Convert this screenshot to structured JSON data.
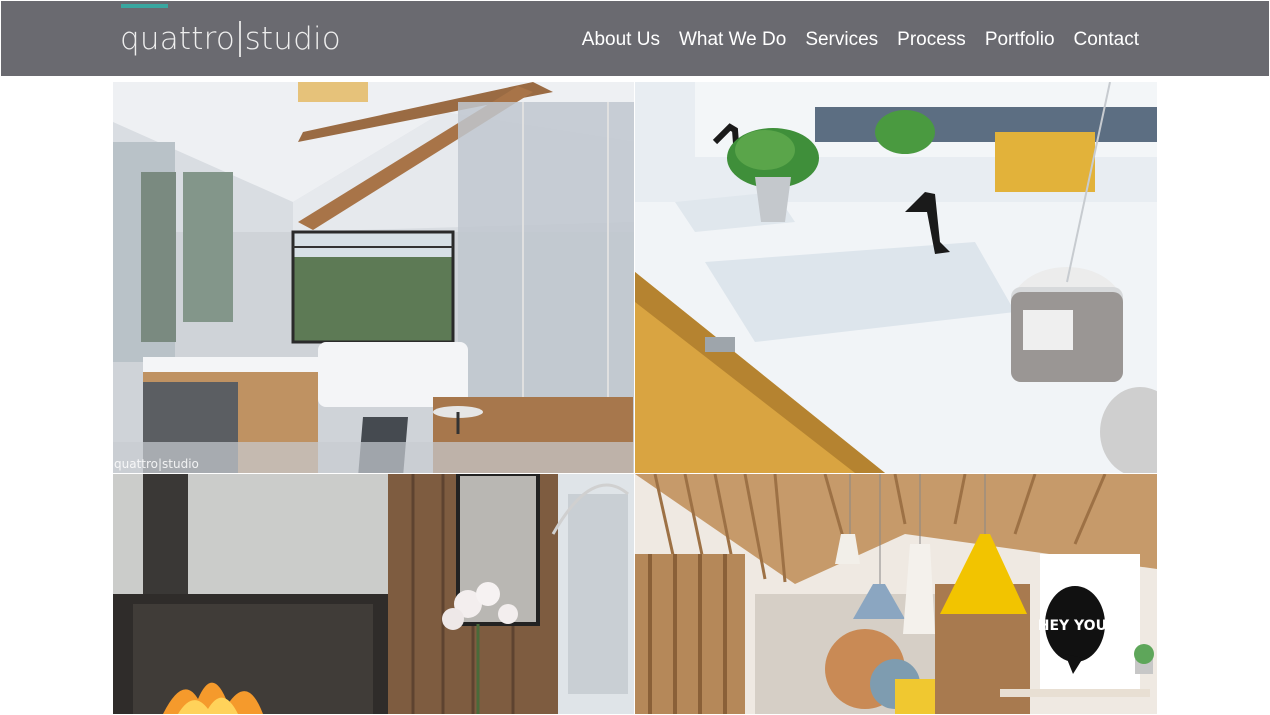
{
  "brand": {
    "logo_left": "quattro",
    "logo_right": "studio",
    "accent_color": "#39a7a0",
    "header_color": "#6a6a70"
  },
  "nav": {
    "items": [
      {
        "label": "About Us"
      },
      {
        "label": "What We Do"
      },
      {
        "label": "Services"
      },
      {
        "label": "Process"
      },
      {
        "label": "Portfolio"
      },
      {
        "label": "Contact"
      }
    ]
  },
  "gallery": {
    "watermark": "quattro|studio",
    "tiles": [
      {
        "subject": "attic bathroom with glass shower and freestanding tub"
      },
      {
        "subject": "white double sink vanity with black faucets and candle"
      },
      {
        "subject": "living room with concrete fireplace and orchids"
      },
      {
        "subject": "open office with wooden slat ceiling and pendant lamps"
      }
    ],
    "poster_text": "HEY YOU."
  }
}
